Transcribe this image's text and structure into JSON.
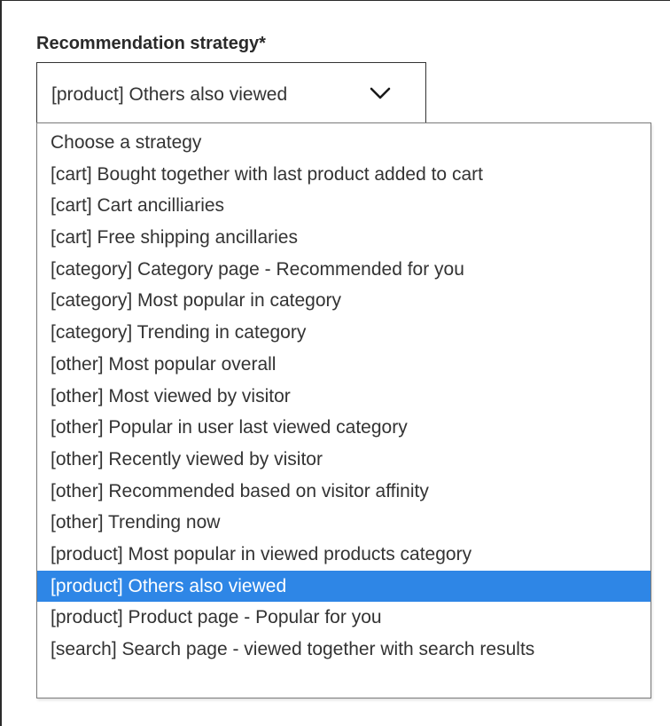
{
  "field": {
    "label": "Recommendation strategy*",
    "value": "[product] Others also viewed",
    "expand_icon": "chevron-down-icon"
  },
  "dropdown": {
    "selected_index": 14,
    "selected_color": "#2e86e6",
    "options": [
      "Choose a strategy",
      "[cart] Bought together with last product added to cart",
      "[cart] Cart ancilliaries",
      "[cart] Free shipping ancillaries",
      "[category] Category page - Recommended for you",
      "[category] Most popular in category",
      "[category] Trending in category",
      "[other] Most popular overall",
      "[other] Most viewed by visitor",
      "[other] Popular in user last viewed category",
      "[other] Recently viewed by visitor",
      "[other] Recommended based on visitor affinity",
      "[other] Trending now",
      "[product] Most popular in viewed products category",
      "[product] Others also viewed",
      "[product] Product page - Popular for you",
      "[search] Search page - viewed together with search results"
    ]
  }
}
